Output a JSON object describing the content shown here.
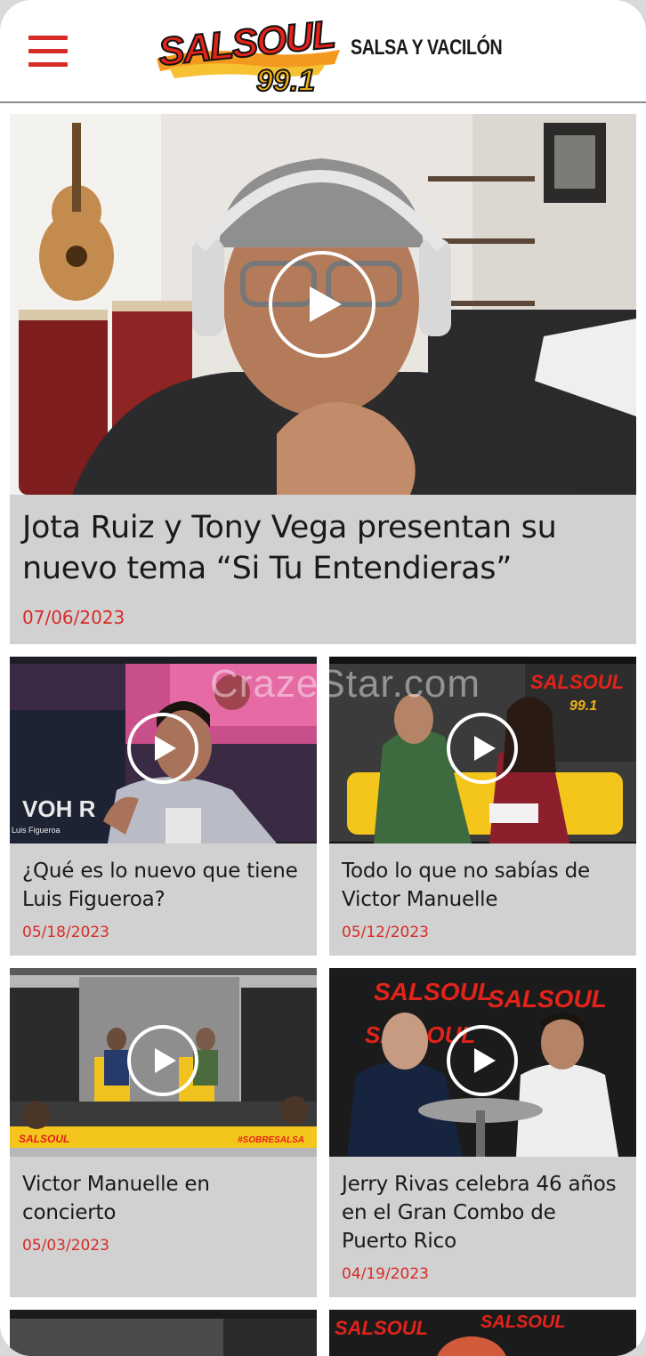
{
  "header": {
    "menu_icon": "hamburger-menu-icon",
    "logo_text": "SALSOUL 99.1",
    "tagline": "SALSA Y VACILÓN"
  },
  "watermark": "CrazeStar.com",
  "featured": {
    "title": "Jota Ruiz y Tony Vega presentan su nuevo tema “Si Tu Entendieras”",
    "date": "07/06/2023",
    "play_icon": "play-circle-icon"
  },
  "articles": [
    {
      "title": "¿Qué es lo nuevo que tiene Luis Figueroa?",
      "date": "05/18/2023",
      "thumb_caption": "Luis Figueroa"
    },
    {
      "title": "Todo lo que no sabías de Victor Manuelle",
      "date": "05/12/2023"
    },
    {
      "title": "Victor Manuelle en concierto",
      "date": "05/03/2023"
    },
    {
      "title": "Jerry Rivas celebra 46 años en el Gran Combo de Puerto Rico",
      "date": "04/19/2023"
    }
  ],
  "colors": {
    "accent_red": "#d72b26",
    "card_bg": "#d1d1d1",
    "logo_orange": "#f39a1e"
  }
}
